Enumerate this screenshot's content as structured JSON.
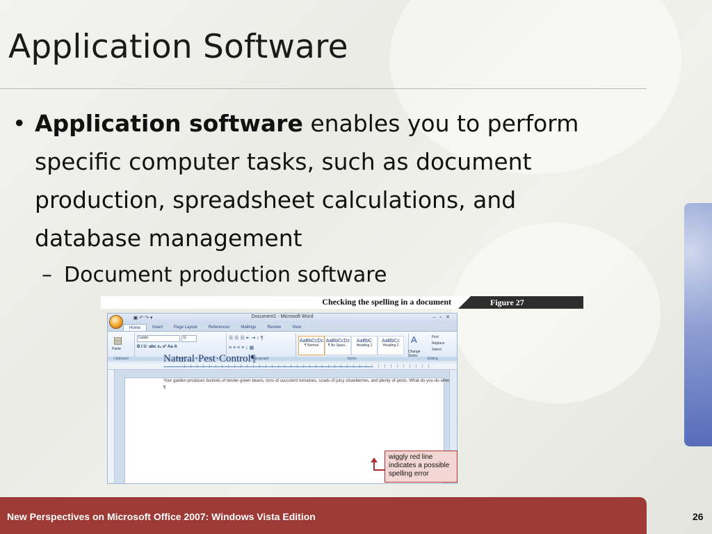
{
  "slide": {
    "title": "Application Software",
    "bullet_bold": "Application software",
    "bullet_rest": " enables you to perform specific computer tasks, such as document production, spreadsheet calculations, and database management",
    "sub_bullet": "Document production software",
    "footer": "New Perspectives on Microsoft Office 2007: Windows Vista Edition",
    "page_number": "26"
  },
  "figure": {
    "caption": "Checking the spelling in a document",
    "label": "Figure  27",
    "callout": "wiggly red line indicates a possible spelling error"
  },
  "word": {
    "title": "Document1 - Microsoft Word",
    "tabs": [
      "Home",
      "Insert",
      "Page Layout",
      "References",
      "Mailings",
      "Review",
      "View"
    ],
    "groups": [
      "Clipboard",
      "Font",
      "Paragraph",
      "Styles",
      "Editing"
    ],
    "clipboard": {
      "paste": "Paste"
    },
    "font": {
      "name": "Calibri",
      "size": "11"
    },
    "styles": [
      {
        "sample": "AaBbCcDc",
        "name": "¶ Normal"
      },
      {
        "sample": "AaBbCcDc",
        "name": "¶ No Spaci..."
      },
      {
        "sample": "AaBbC",
        "name": "Heading 1"
      },
      {
        "sample": "AaBbCc",
        "name": "Heading 2"
      }
    ],
    "change_styles": "Change Styles",
    "editing": {
      "find": "Find",
      "replace": "Replace",
      "select": "Select"
    },
    "doc_heading": "Natural·Pest·Control¶",
    "doc_paragraph": "Your·garden·produces·bushels·of·tender·green·beans,·tons·of·succulent·tomatoes,·scads·of·juicy·strawberries,·and·plenty·of·pests.·What·do·you·do·when·the·cut·worms·bigin·munching·on·those·beans?¶"
  },
  "colors": {
    "footer_bg": "#9d3a35",
    "callout_border": "#b03030"
  }
}
